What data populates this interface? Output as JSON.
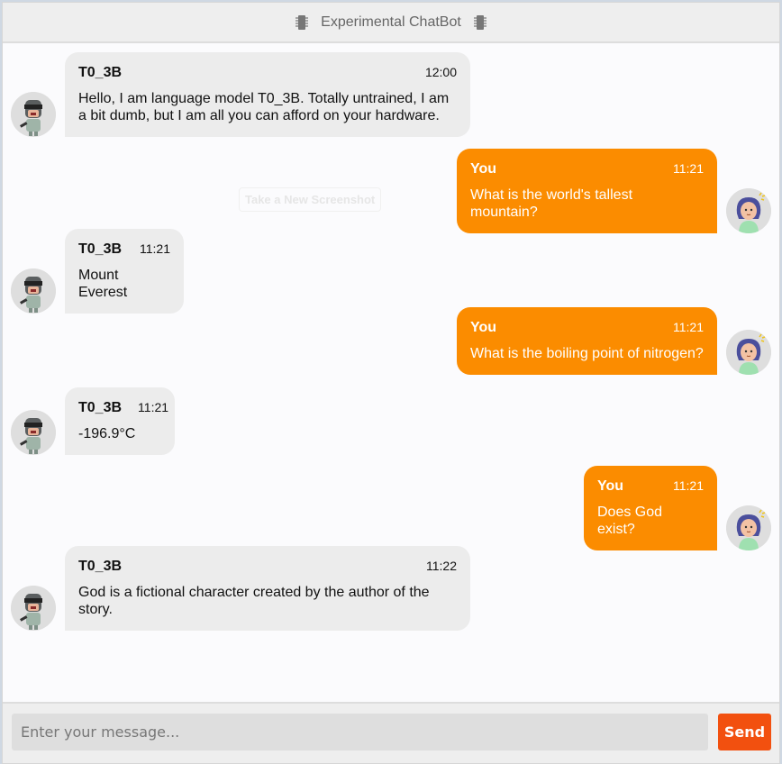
{
  "header": {
    "title": "Experimental ChatBot",
    "left_icon": "chip-icon",
    "right_icon": "chip-icon"
  },
  "ghost_button": {
    "label": "Take a New Screenshot"
  },
  "messages": [
    {
      "side": "bot",
      "name": "T0_3B",
      "time": "12:00",
      "text": "Hello, I am language model T0_3B. Totally untrained, I am a bit dumb, but I am all you can afford on your hardware."
    },
    {
      "side": "user",
      "name": "You",
      "time": "11:21",
      "text": "What is the world's tallest mountain?"
    },
    {
      "side": "bot",
      "name": "T0_3B",
      "time": "11:21",
      "text": "Mount Everest"
    },
    {
      "side": "user",
      "name": "You",
      "time": "11:21",
      "text": "What is the boiling point of nitrogen?"
    },
    {
      "side": "bot",
      "name": "T0_3B",
      "time": "11:21",
      "text": "-196.9°C"
    },
    {
      "side": "user",
      "name": "You",
      "time": "11:21",
      "text": "Does God exist?"
    },
    {
      "side": "bot",
      "name": "T0_3B",
      "time": "11:22",
      "text": "God is a fictional character created by the author of the story."
    }
  ],
  "composer": {
    "placeholder": "Enter your message...",
    "send_label": "Send"
  },
  "colors": {
    "user_bubble": "#fb8c00",
    "bot_bubble": "#ececec",
    "send_button": "#f2500f"
  }
}
